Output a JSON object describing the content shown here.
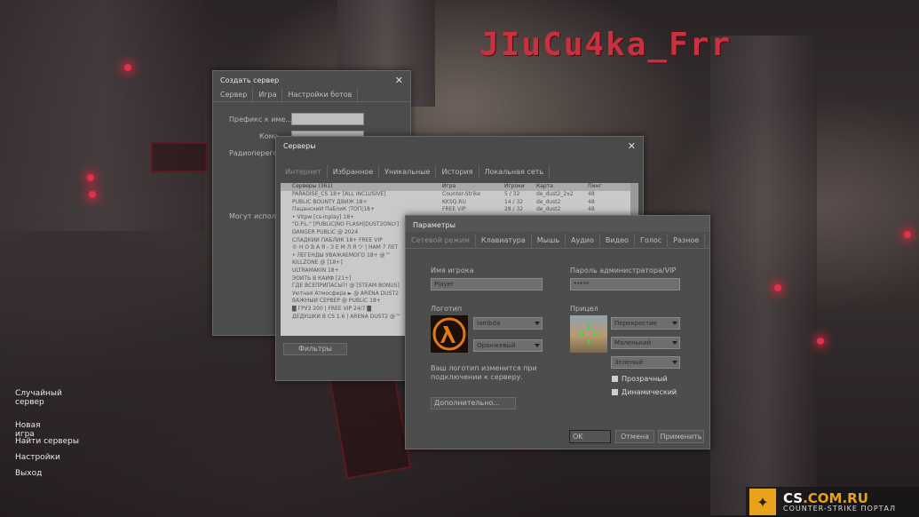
{
  "brand_text": "JIuCu4ka_Frr",
  "main_menu": [
    "Случайный сервер",
    "Новая игра",
    "Найти серверы",
    "Настройки",
    "Выход"
  ],
  "watermark": {
    "title_a": "CS",
    "title_b": ".COM.RU",
    "subtitle": "COUNTER-STRIKE ПОРТАЛ"
  },
  "create_server": {
    "title": "Создать сервер",
    "tabs": [
      "Сервер",
      "Игра",
      "Настройки ботов"
    ],
    "prefix_label": "Префикс к име...",
    "team_label": "Кома",
    "radio_label": "Радиоперегов",
    "use_label": "Могут использ"
  },
  "servers": {
    "title": "Серверы",
    "tabs": [
      "Интернет",
      "Избранное",
      "Уникальные",
      "История",
      "Локальная сеть"
    ],
    "columns": [
      "Серверы (361)",
      "Игра",
      "Игроки",
      "Карта",
      "Пинг"
    ],
    "rows": [
      [
        "PARADISE_CS 18+ [ALL INCLUSIVE]",
        "Counter-Strike",
        "5 / 32",
        "de_dust2_2x2",
        "48"
      ],
      [
        "PUBLIC BOUNTY ДВИЖ 18+",
        "KKSQ.RU",
        "14 / 32",
        "de_dust2",
        "48"
      ],
      [
        "ПацанскиЙ ПаБлиК ¦ТОП¦18+",
        "FREE VIP",
        "28 / 32",
        "de_dust2",
        "48"
      ],
      [
        "• Vitpw [cs-inplay] 18+",
        "",
        "",
        "",
        ""
      ],
      [
        "\"D.P.L.\" [PUBLIC|NO FLASH|DUST2ONLY]",
        "",
        "",
        "",
        ""
      ],
      [
        "DANGER PUBLIC @ 2024",
        "",
        "",
        "",
        ""
      ],
      [
        "СЛАДКИЙ ПАБЛИК 18+ FREE VIP",
        "",
        "",
        "",
        ""
      ],
      [
        "© Н О В А Я - З Е М Л Я ツ | НАМ 7 ЛЕТ",
        "",
        "",
        "",
        ""
      ],
      [
        "• ЛЕГЕНДЫ УВАЖАЕМОГО 18+ @™",
        "",
        "",
        "",
        ""
      ],
      [
        "KILLZONE @ [18+]",
        "",
        "",
        "",
        ""
      ],
      [
        "ULTRAMAKIN 18+",
        "",
        "",
        "",
        ""
      ],
      [
        "ЭОИТЬ В КАЙФ [21+]",
        "",
        "",
        "",
        ""
      ],
      [
        "ГДЕ ВСЕПРИПАСЫ?! @ [STEAM BONUS]",
        "",
        "",
        "",
        ""
      ],
      [
        "Уютная Атмосфера ► @ ARENA DUST2",
        "",
        "",
        "",
        ""
      ],
      [
        "ВАЖНЫЙ СЕРВЕР @ PUBLIC 18+",
        "",
        "",
        "",
        ""
      ],
      [
        "█ ГРУЗ 200 | FREE VIP 24/7 █",
        "",
        "",
        "",
        ""
      ],
      [
        "ДЕДУШКИ В CS 1.6 | ARENA DUST2 @™",
        "",
        "",
        "",
        ""
      ]
    ],
    "filters_button": "Фильтры"
  },
  "params": {
    "title": "Параметры",
    "tabs": [
      "Сетевой режим",
      "Клавиатура",
      "Мышь",
      "Аудио",
      "Видео",
      "Голос",
      "Разное"
    ],
    "player_name_label": "Имя игрока",
    "player_name_value": "Player",
    "admin_pass_label": "Пароль администратора/VIP",
    "admin_pass_value": "*****",
    "logo_label": "Логотип",
    "logo_select": "lambda",
    "logo_color_select": "Оранжевый",
    "crosshair_label": "Прицел",
    "crosshair_type": "Перекрестие",
    "crosshair_size": "Маленький",
    "crosshair_color": "Зеленый",
    "transparent_label": "Прозрачный",
    "dynamic_label": "Динамический",
    "logo_note": "Ваш логотип изменится при подключении к серверу.",
    "advanced_button": "Дополнительно...",
    "ok_button": "OK",
    "cancel_button": "Отмена",
    "apply_button": "Применить"
  }
}
